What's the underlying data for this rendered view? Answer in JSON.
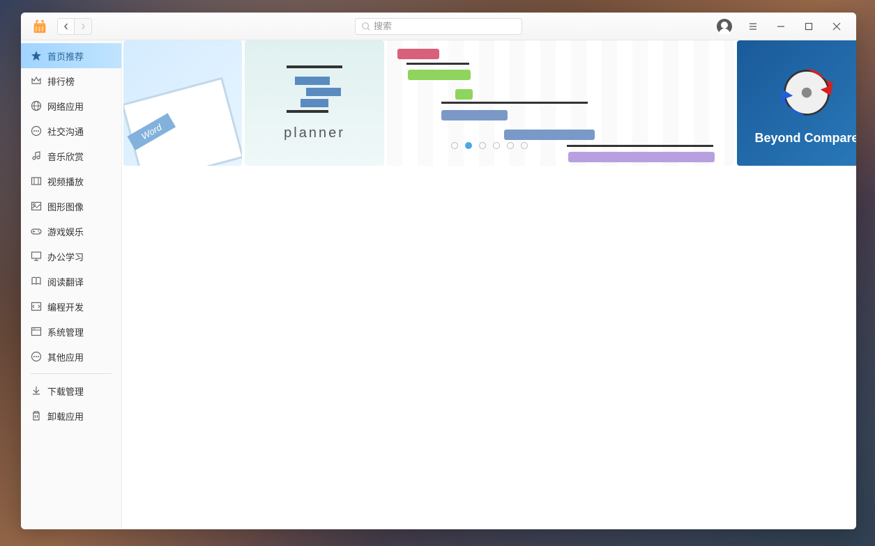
{
  "search": {
    "placeholder": "搜索"
  },
  "sidebar": {
    "items": [
      {
        "id": "home",
        "label": "首页推荐",
        "icon": "star"
      },
      {
        "id": "rank",
        "label": "排行榜",
        "icon": "crown"
      },
      {
        "id": "network",
        "label": "网络应用",
        "icon": "globe"
      },
      {
        "id": "social",
        "label": "社交沟通",
        "icon": "chat"
      },
      {
        "id": "music",
        "label": "音乐欣赏",
        "icon": "music"
      },
      {
        "id": "video",
        "label": "视频播放",
        "icon": "video"
      },
      {
        "id": "graphics",
        "label": "图形图像",
        "icon": "image"
      },
      {
        "id": "games",
        "label": "游戏娱乐",
        "icon": "gamepad"
      },
      {
        "id": "office",
        "label": "办公学习",
        "icon": "monitor"
      },
      {
        "id": "reading",
        "label": "阅读翻译",
        "icon": "book"
      },
      {
        "id": "dev",
        "label": "编程开发",
        "icon": "code"
      },
      {
        "id": "system",
        "label": "系统管理",
        "icon": "dashboard"
      },
      {
        "id": "other",
        "label": "其他应用",
        "icon": "dots"
      }
    ],
    "footer_items": [
      {
        "id": "download",
        "label": "下载管理",
        "icon": "download"
      },
      {
        "id": "uninstall",
        "label": "卸载应用",
        "icon": "trash"
      }
    ],
    "active_index": 0
  },
  "banners": {
    "word_tag": "Word",
    "planner_label": "planner",
    "beyond_compare_label": "Beyond Compare"
  },
  "carousel": {
    "total": 6,
    "active": 1
  }
}
